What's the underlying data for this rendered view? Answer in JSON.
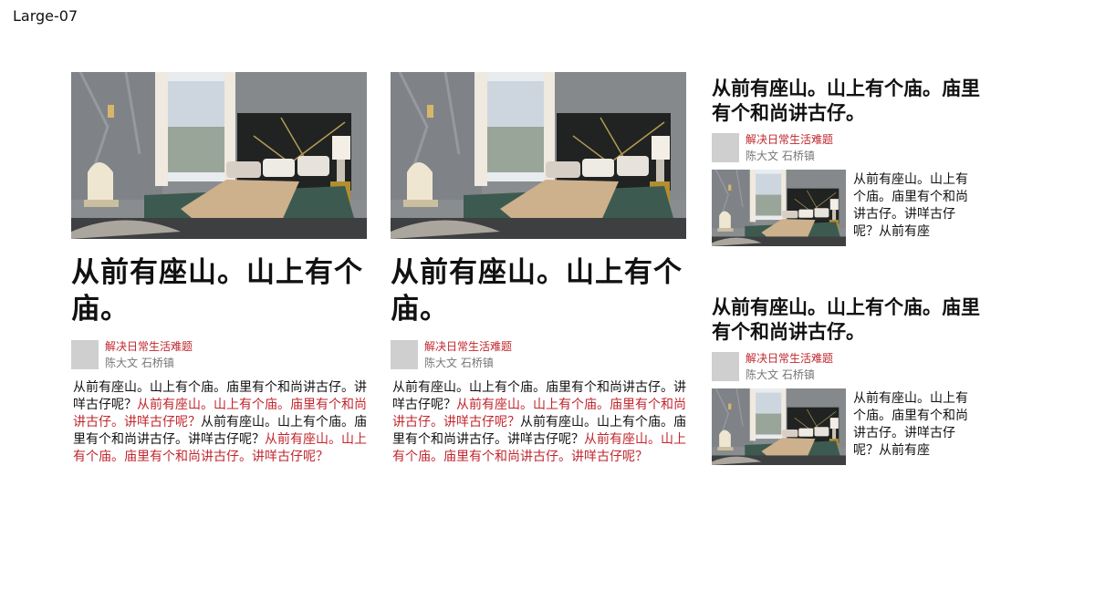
{
  "frame_label": "Large-07",
  "cards": [
    {
      "title": "从前有座山。山上有个庙。",
      "category": "解决日常生活难题",
      "author": "陈大文 石桥镇",
      "body_black_1": "从前有座山。山上有个庙。庙里有个和尚讲古仔。讲咩古仔呢？",
      "body_red_1": "从前有座山。山上有个庙。庙里有个和尚讲古仔。讲咩古仔呢？",
      "body_black_2": "从前有座山。山上有个庙。庙里有个和尚讲古仔。讲咩古仔呢？",
      "body_red_2": "从前有座山。山上有个庙。庙里有个和尚讲古仔。讲咩古仔呢？"
    },
    {
      "title": "从前有座山。山上有个庙。",
      "category": "解决日常生活难题",
      "author": "陈大文 石桥镇",
      "body_black_1": "从前有座山。山上有个庙。庙里有个和尚讲古仔。讲咩古仔呢？",
      "body_red_1": "从前有座山。山上有个庙。庙里有个和尚讲古仔。讲咩古仔呢？",
      "body_black_2": "从前有座山。山上有个庙。庙里有个和尚讲古仔。讲咩古仔呢？",
      "body_red_2": "从前有座山。山上有个庙。庙里有个和尚讲古仔。讲咩古仔呢？"
    }
  ],
  "side": [
    {
      "title": "从前有座山。山上有个庙。庙里有个和尚讲古仔。",
      "category": "解决日常生活难题",
      "author": "陈大文 石桥镇",
      "snippet": "从前有座山。山上有个庙。庙里有个和尚讲古仔。讲咩古仔呢？从前有座"
    },
    {
      "title": "从前有座山。山上有个庙。庙里有个和尚讲古仔。",
      "category": "解决日常生活难题",
      "author": "陈大文 石桥镇",
      "snippet": "从前有座山。山上有个庙。庙里有个和尚讲古仔。讲咩古仔呢？从前有座"
    }
  ],
  "colors": {
    "accent_red": "#c0262d",
    "meta_gray": "#777777",
    "avatar_gray": "#cfcfcf"
  }
}
